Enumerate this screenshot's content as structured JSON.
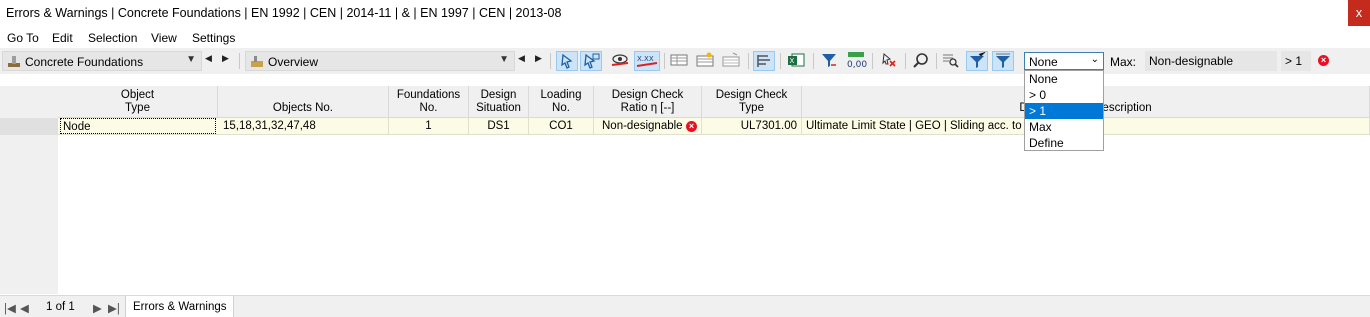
{
  "window": {
    "title": "Errors & Warnings | Concrete Foundations | EN 1992 | CEN | 2014-11 | & | EN 1997 | CEN | 2013-08",
    "close_label": "x"
  },
  "menu": [
    "Go To",
    "Edit",
    "Selection",
    "View",
    "Settings"
  ],
  "toolbar": {
    "module_combo": "Concrete Foundations",
    "view_combo": "Overview",
    "filter_value": "None",
    "max_label": "Max:",
    "max_value": "Non-designable",
    "threshold": "> 1"
  },
  "filter_options": [
    "None",
    "> 0",
    "> 1",
    "Max",
    "Define"
  ],
  "filter_selected_index": 2,
  "table": {
    "headers": [
      [
        "Object",
        "Type"
      ],
      [
        "",
        "Objects No."
      ],
      [
        "Foundations",
        "No."
      ],
      [
        "Design",
        "Situation"
      ],
      [
        "Loading",
        "No."
      ],
      [
        "Design Check",
        "Ratio η [--]"
      ],
      [
        "Design Check",
        "Type"
      ],
      [
        "",
        "Design Check Description"
      ]
    ],
    "rows": [
      [
        "Node",
        "15,18,31,32,47,48",
        "1",
        "DS1",
        "CO1",
        "Non-designable",
        "UL7301.00",
        "Ultimate Limit State | GEO | Sliding acc. to EN 1997-1"
      ]
    ]
  },
  "status": {
    "page": "1 of 1",
    "tab": "Errors & Warnings"
  },
  "colors": {
    "accent": "#0078d7",
    "error": "#e81123",
    "row_highlight": "#fcfce6"
  }
}
